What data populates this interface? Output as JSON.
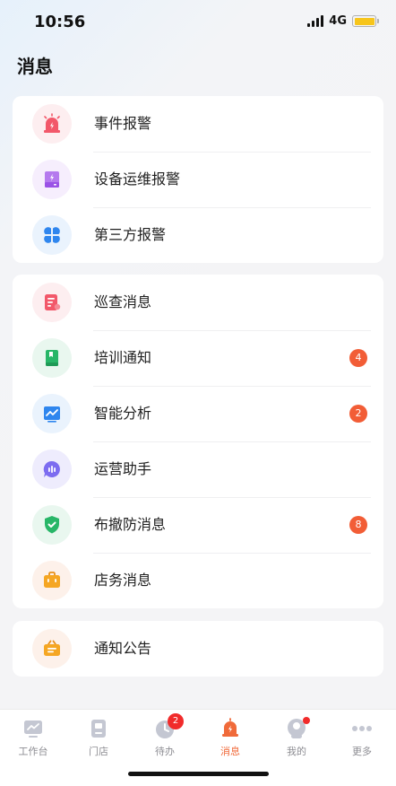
{
  "status": {
    "time": "10:56",
    "network": "4G"
  },
  "page": {
    "title": "消息"
  },
  "groups": [
    {
      "items": [
        {
          "label": "事件报警",
          "icon": "alarm-siren-icon",
          "color": "#f2586a",
          "bg": "#fdeef0"
        },
        {
          "label": "设备运维报警",
          "icon": "device-alert-icon",
          "color": "#a65ce9",
          "bg": "#f6eefd"
        },
        {
          "label": "第三方报警",
          "icon": "four-petal-icon",
          "color": "#2f86ee",
          "bg": "#eaf3fd"
        }
      ]
    },
    {
      "items": [
        {
          "label": "巡查消息",
          "icon": "inspection-doc-icon",
          "color": "#f2586a",
          "bg": "#fdeef0"
        },
        {
          "label": "培训通知",
          "icon": "training-book-icon",
          "color": "#28b668",
          "bg": "#e9f7ef",
          "badge": "4"
        },
        {
          "label": "智能分析",
          "icon": "smart-analysis-icon",
          "color": "#2f86ee",
          "bg": "#eaf3fd",
          "badge": "2"
        },
        {
          "label": "运营助手",
          "icon": "assistant-chat-icon",
          "color": "#7c6cf0",
          "bg": "#eeecfd"
        },
        {
          "label": "布撤防消息",
          "icon": "shield-check-icon",
          "color": "#28b668",
          "bg": "#e9f7ef",
          "badge": "8"
        },
        {
          "label": "店务消息",
          "icon": "store-briefcase-icon",
          "color": "#f5a623",
          "bg": "#fdf1ea"
        }
      ]
    },
    {
      "items": [
        {
          "label": "通知公告",
          "icon": "announcement-bag-icon",
          "color": "#f5a623",
          "bg": "#fdf1ea"
        }
      ]
    }
  ],
  "tabbar": {
    "active_color": "#f06a3a",
    "inactive_color": "#8d8d93",
    "items": [
      {
        "label": "工作台",
        "icon": "workbench-icon"
      },
      {
        "label": "门店",
        "icon": "store-icon"
      },
      {
        "label": "待办",
        "icon": "todo-icon",
        "badge": "2"
      },
      {
        "label": "消息",
        "icon": "message-bell-icon",
        "active": true
      },
      {
        "label": "我的",
        "icon": "profile-icon",
        "dot": true
      },
      {
        "label": "更多",
        "icon": "more-dots-icon"
      }
    ]
  }
}
